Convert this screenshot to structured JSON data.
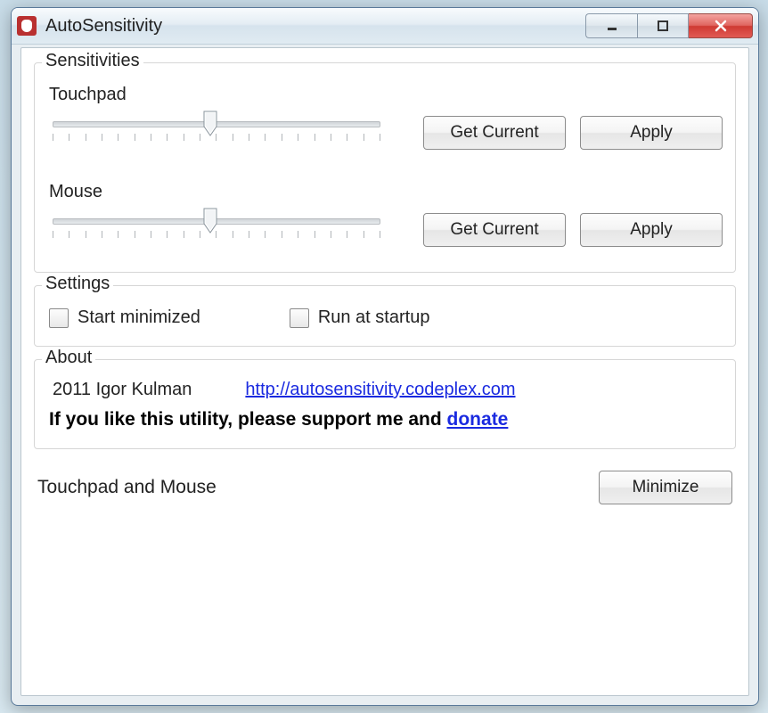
{
  "window": {
    "title": "AutoSensitivity",
    "icon": "mouse-icon"
  },
  "sensitivities": {
    "legend": "Sensitivities",
    "touchpad": {
      "label": "Touchpad",
      "value_percent": 48,
      "get_current_label": "Get Current",
      "apply_label": "Apply"
    },
    "mouse": {
      "label": "Mouse",
      "value_percent": 48,
      "get_current_label": "Get Current",
      "apply_label": "Apply"
    }
  },
  "settings": {
    "legend": "Settings",
    "start_minimized_label": "Start minimized",
    "start_minimized_checked": false,
    "run_at_startup_label": "Run at startup",
    "run_at_startup_checked": false
  },
  "about": {
    "legend": "About",
    "copyright": "2011 Igor Kulman",
    "url_text": "http://autosensitivity.codeplex.com",
    "support_prefix": "If you like this utility, please support me and ",
    "donate_label": "donate"
  },
  "footer": {
    "status": "Touchpad and Mouse",
    "minimize_label": "Minimize"
  }
}
